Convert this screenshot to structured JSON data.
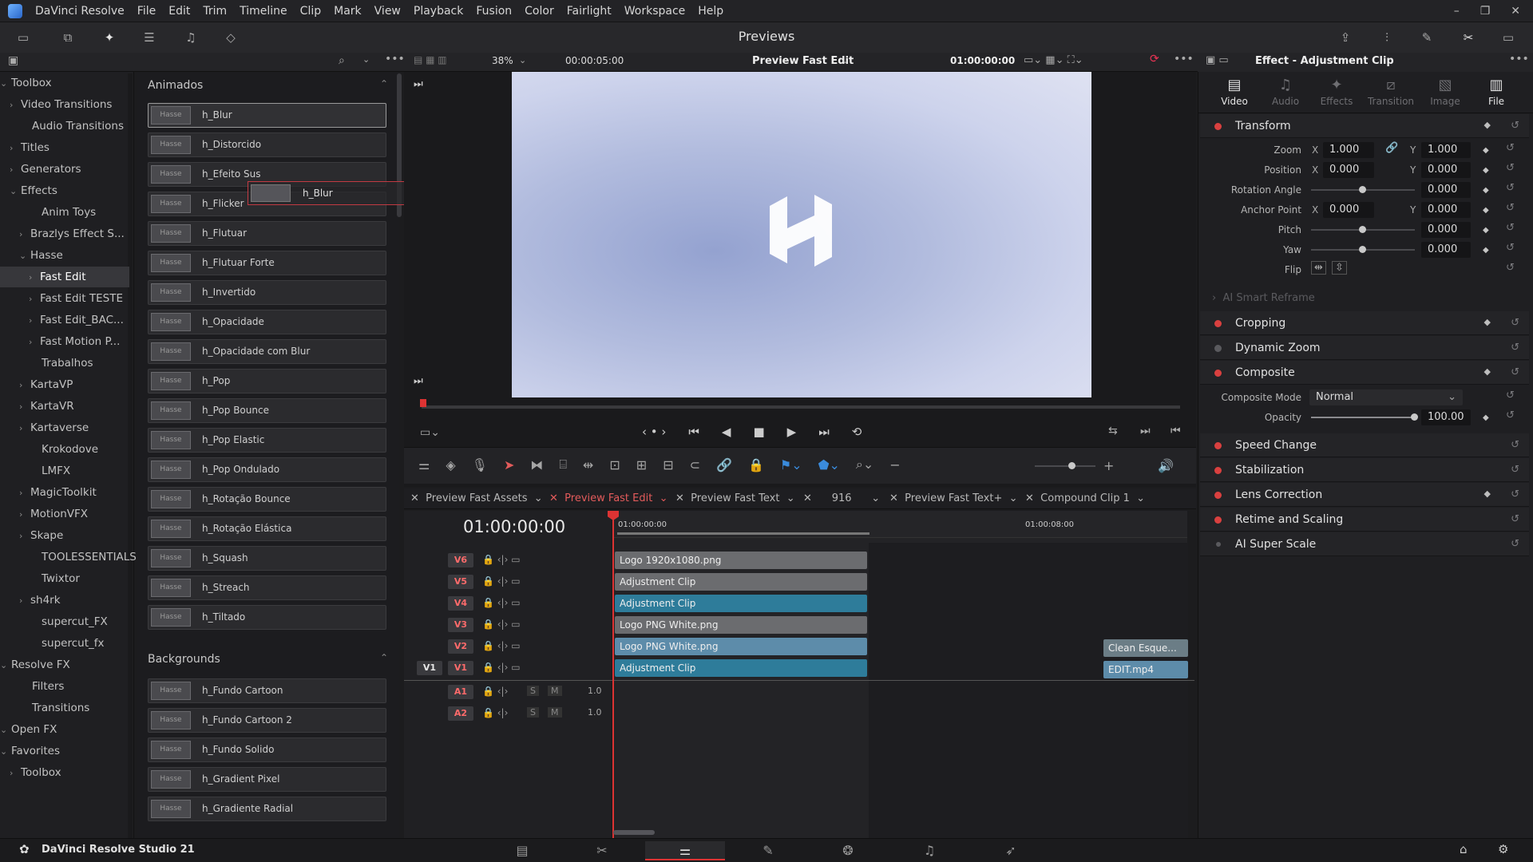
{
  "menubar": {
    "app_name": "DaVinci Resolve",
    "items": [
      "File",
      "Edit",
      "Trim",
      "Timeline",
      "Clip",
      "Mark",
      "View",
      "Playback",
      "Fusion",
      "Color",
      "Fairlight",
      "Workspace",
      "Help"
    ]
  },
  "toolbar": {
    "title": "Previews"
  },
  "viewer_bar": {
    "zoom": "38%",
    "duration": "00:00:05:00",
    "timeline_name": "Preview Fast Edit",
    "timecode": "01:00:00:00"
  },
  "toolbox_tree": [
    {
      "label": "Toolbox",
      "arrow": "⌄"
    },
    {
      "label": "Video Transitions",
      "arrow": "›"
    },
    {
      "label": "Audio Transitions",
      "arrow": ""
    },
    {
      "label": "Titles",
      "arrow": "›"
    },
    {
      "label": "Generators",
      "arrow": "›"
    },
    {
      "label": "Effects",
      "arrow": "⌄"
    },
    {
      "label": "Anim Toys",
      "arrow": ""
    },
    {
      "label": "Brazlys Effect S...",
      "arrow": "›"
    },
    {
      "label": "Hasse",
      "arrow": "⌄"
    },
    {
      "label": "Fast Edit",
      "arrow": "›"
    },
    {
      "label": "Fast Edit TESTE",
      "arrow": "›"
    },
    {
      "label": "Fast Edit_BAC...",
      "arrow": "›"
    },
    {
      "label": "Fast Motion P...",
      "arrow": "›"
    },
    {
      "label": "Trabalhos",
      "arrow": ""
    },
    {
      "label": "KartaVP",
      "arrow": "›"
    },
    {
      "label": "KartaVR",
      "arrow": "›"
    },
    {
      "label": "Kartaverse",
      "arrow": "›"
    },
    {
      "label": "Krokodove",
      "arrow": ""
    },
    {
      "label": "LMFX",
      "arrow": ""
    },
    {
      "label": "MagicToolkit",
      "arrow": "›"
    },
    {
      "label": "MotionVFX",
      "arrow": "›"
    },
    {
      "label": "Skape",
      "arrow": "›"
    },
    {
      "label": "TOOLESSENTIALS",
      "arrow": ""
    },
    {
      "label": "Twixtor",
      "arrow": ""
    },
    {
      "label": "sh4rk",
      "arrow": "›"
    },
    {
      "label": "supercut_FX",
      "arrow": ""
    },
    {
      "label": "supercut_fx",
      "arrow": ""
    },
    {
      "label": "Resolve FX",
      "arrow": "⌄"
    },
    {
      "label": "Filters",
      "arrow": ""
    },
    {
      "label": "Transitions",
      "arrow": ""
    },
    {
      "label": "Open FX",
      "arrow": "⌄"
    },
    {
      "label": "Favorites",
      "arrow": "⌄"
    },
    {
      "label": "Toolbox",
      "arrow": "›"
    }
  ],
  "effects_panel": {
    "section_animados": "Animados",
    "animados": [
      "h_Blur",
      "h_Distorcido",
      "h_Efeito Sus",
      "h_Flicker",
      "h_Flutuar",
      "h_Flutuar Forte",
      "h_Invertido",
      "h_Opacidade",
      "h_Opacidade com Blur",
      "h_Pop",
      "h_Pop Bounce",
      "h_Pop Elastic",
      "h_Pop Ondulado",
      "h_Rotação Bounce",
      "h_Rotação Elástica",
      "h_Squash",
      "h_Streach",
      "h_Tiltado"
    ],
    "section_backgrounds": "Backgrounds",
    "backgrounds": [
      "h_Fundo Cartoon",
      "h_Fundo Cartoon 2",
      "h_Fundo Solido",
      "h_Gradient Pixel",
      "h_Gradiente Radial"
    ],
    "drag_label": "h_Blur",
    "thumb_text": "Hasse"
  },
  "timeline": {
    "timecode": "01:00:00:00",
    "ruler_start": "01:00:00:00",
    "ruler_mark": "01:00:08:00",
    "tabs": [
      "Preview Fast Assets",
      "Preview Fast Edit",
      "Preview Fast Text",
      "916",
      "Preview Fast Text+",
      "Compound Clip 1"
    ],
    "tracks": [
      {
        "label": "V6",
        "clip": "Logo 1920x1080.png"
      },
      {
        "label": "V5",
        "clip": "Adjustment Clip"
      },
      {
        "label": "V4",
        "clip": "Adjustment Clip"
      },
      {
        "label": "V3",
        "clip": "Logo PNG White.png"
      },
      {
        "label": "V2",
        "clip": "Logo PNG White.png"
      },
      {
        "label": "V1",
        "clip": "Adjustment Clip"
      }
    ],
    "audio": [
      {
        "label": "A1",
        "level": "1.0"
      },
      {
        "label": "A2",
        "level": "1.0"
      }
    ],
    "source_v1": "V1",
    "solo": "S",
    "mute": "M",
    "far_clips": [
      "Clean Esque...",
      "EDIT.mp4"
    ]
  },
  "inspector": {
    "title": "Effect - Adjustment Clip",
    "tabs": [
      "Video",
      "Audio",
      "Effects",
      "Transition",
      "Image",
      "File"
    ],
    "transform": {
      "title": "Transform",
      "zoom_label": "Zoom",
      "zoom_x": "1.000",
      "zoom_y": "1.000",
      "position_label": "Position",
      "position_x": "0.000",
      "position_y": "0.000",
      "rotation_label": "Rotation Angle",
      "rotation": "0.000",
      "anchor_label": "Anchor Point",
      "anchor_x": "0.000",
      "anchor_y": "0.000",
      "pitch_label": "Pitch",
      "pitch": "0.000",
      "yaw_label": "Yaw",
      "yaw": "0.000",
      "flip_label": "Flip"
    },
    "ai_smart_reframe": "AI Smart Reframe",
    "cropping": "Cropping",
    "dynamic_zoom": "Dynamic Zoom",
    "composite": {
      "title": "Composite",
      "mode_label": "Composite Mode",
      "mode": "Normal",
      "opacity_label": "Opacity",
      "opacity": "100.00"
    },
    "speed_change": "Speed Change",
    "stabilization": "Stabilization",
    "lens_correction": "Lens Correction",
    "retime": "Retime and Scaling",
    "ai_super_scale": "AI Super Scale",
    "axis_x": "X",
    "axis_y": "Y"
  },
  "bottombar": {
    "app_label": "DaVinci Resolve Studio 21"
  },
  "colors": {
    "accent_red": "#d33333",
    "clip_blue": "#2e7c9a",
    "clip_grey": "#6b6c6f"
  }
}
